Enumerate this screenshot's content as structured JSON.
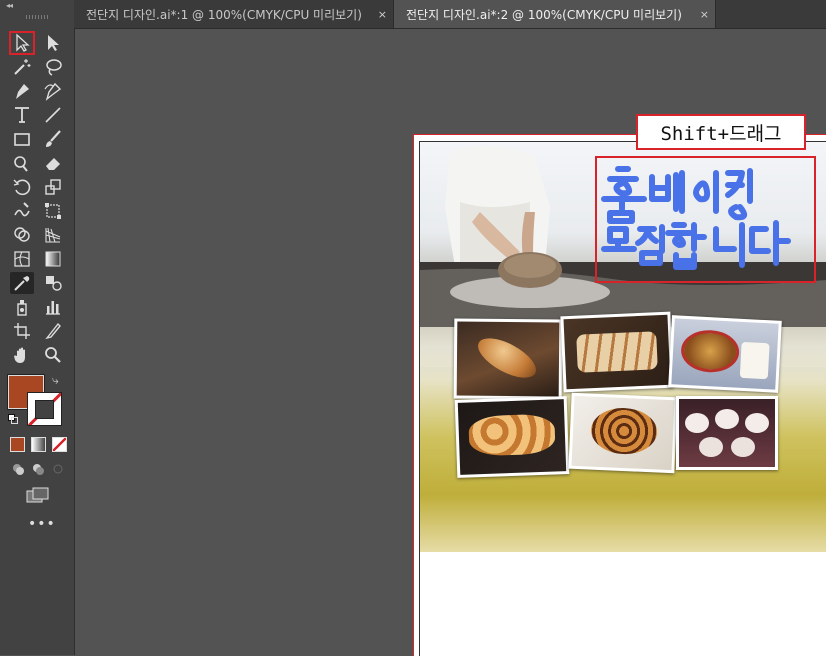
{
  "toolbar": {
    "collapse_glyph": "◂◂",
    "more_glyph": "•••",
    "tools": [
      {
        "name": "selection-tool",
        "icon": "selection-arrow-icon"
      },
      {
        "name": "direct-selection-tool",
        "icon": "direct-selection-arrow-icon"
      },
      {
        "name": "magic-wand-tool",
        "icon": "magic-wand-icon"
      },
      {
        "name": "lasso-tool",
        "icon": "lasso-icon"
      },
      {
        "name": "pen-tool",
        "icon": "pen-icon"
      },
      {
        "name": "curvature-tool",
        "icon": "curvature-icon"
      },
      {
        "name": "type-tool",
        "icon": "type-icon"
      },
      {
        "name": "line-tool",
        "icon": "line-segment-icon"
      },
      {
        "name": "rectangle-tool",
        "icon": "rectangle-icon"
      },
      {
        "name": "paintbrush-tool",
        "icon": "paintbrush-icon"
      },
      {
        "name": "shaper-tool",
        "icon": "shaper-icon"
      },
      {
        "name": "eraser-tool",
        "icon": "eraser-icon"
      },
      {
        "name": "rotate-tool",
        "icon": "rotate-icon"
      },
      {
        "name": "scale-tool",
        "icon": "scale-icon"
      },
      {
        "name": "warp-tool",
        "icon": "warp-icon"
      },
      {
        "name": "free-transform-tool",
        "icon": "free-transform-icon"
      },
      {
        "name": "shape-builder-tool",
        "icon": "shape-builder-icon"
      },
      {
        "name": "perspective-grid-tool",
        "icon": "perspective-grid-icon"
      },
      {
        "name": "mesh-tool",
        "icon": "mesh-icon"
      },
      {
        "name": "gradient-tool",
        "icon": "gradient-icon"
      },
      {
        "name": "eyedropper-tool",
        "icon": "eyedropper-icon"
      },
      {
        "name": "blend-tool",
        "icon": "blend-icon"
      },
      {
        "name": "symbol-sprayer-tool",
        "icon": "symbol-sprayer-icon"
      },
      {
        "name": "column-graph-tool",
        "icon": "column-graph-icon"
      },
      {
        "name": "artboard-tool",
        "icon": "artboard-icon"
      },
      {
        "name": "slice-tool",
        "icon": "slice-icon"
      },
      {
        "name": "hand-tool",
        "icon": "hand-icon"
      },
      {
        "name": "zoom-tool",
        "icon": "zoom-icon"
      }
    ],
    "fill_color": "#a84722",
    "stroke_color": "none"
  },
  "tabs": [
    {
      "label": "전단지 디자인.ai*:1 @ 100%(CMYK/CPU 미리보기)",
      "close": "×",
      "active": false
    },
    {
      "label": "전단지 디자인.ai*:2 @ 100%(CMYK/CPU 미리보기)",
      "close": "×",
      "active": true
    }
  ],
  "annotation": {
    "note": "Shift+드래그",
    "highlight_color": "#d8232a"
  },
  "artwork": {
    "handwritten_headline": "홈베이킹 모집합니다",
    "ink_color": "#4a72e8",
    "photos": [
      "bread-roll-photo",
      "sliced-bread-photo",
      "cookies-milk-photo",
      "braided-bread-photo",
      "cinnamon-roll-photo",
      "cupcakes-photo"
    ]
  }
}
